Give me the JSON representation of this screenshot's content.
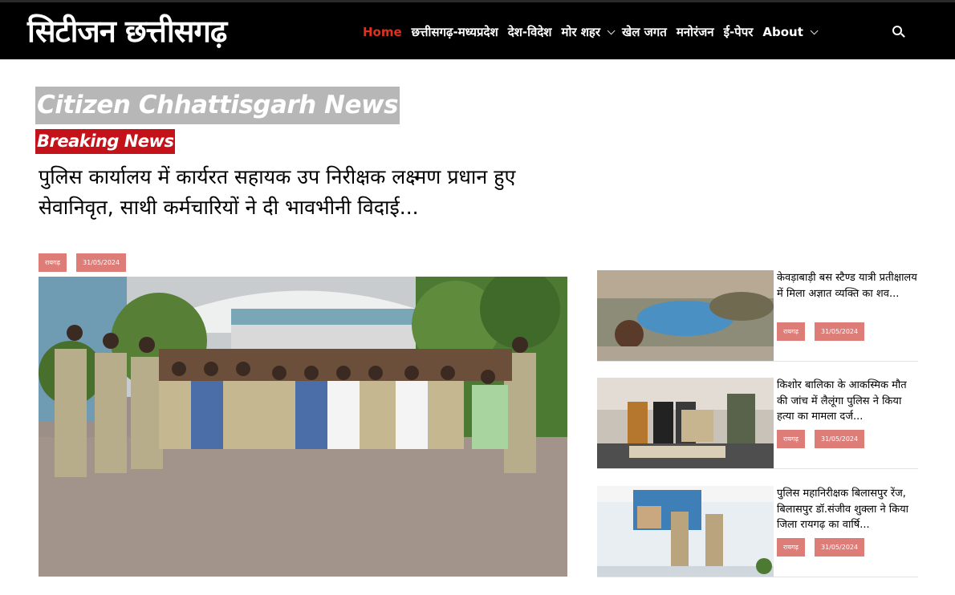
{
  "header": {
    "logo_text": "सिटीजन छत्तीसगढ़",
    "nav": [
      {
        "label": "Home",
        "active": true,
        "dropdown": false
      },
      {
        "label": "छत्तीसगढ़-मध्यप्रदेश",
        "active": false,
        "dropdown": false
      },
      {
        "label": "देश-विदेश",
        "active": false,
        "dropdown": false
      },
      {
        "label": "मोर शहर",
        "active": false,
        "dropdown": true
      },
      {
        "label": "खेल जगत",
        "active": false,
        "dropdown": false
      },
      {
        "label": "मनोरंजन",
        "active": false,
        "dropdown": false
      },
      {
        "label": "ई-पेपर",
        "active": false,
        "dropdown": false
      },
      {
        "label": "About",
        "active": false,
        "dropdown": true
      }
    ],
    "search_icon": "search-icon"
  },
  "banner": {
    "site_name": "Citizen Chhattisgarh News",
    "breaking_label": "Breaking News"
  },
  "main_article": {
    "title": "पुलिस कार्यालय में कार्यरत सहायक उप निरीक्षक लक्ष्मण प्रधान हुए सेवानिवृत, साथी कर्मचारियों ने दी भावभीनी विदाई...",
    "category": "रायगढ़",
    "date": "31/05/2024"
  },
  "sidebar": [
    {
      "title": "केवड़ाबाड़ी बस स्टैण्ड यात्री प्रतीक्षालय में मिला अज्ञात व्यक्ति का शव...",
      "category": "रायगढ़",
      "date": "31/05/2024"
    },
    {
      "title": "किशोर बालिका के आकस्मिक मौत की जांच में लैलूंगा पुलिस ने किया हत्या का मामला दर्ज...",
      "category": "रायगढ़",
      "date": "31/05/2024"
    },
    {
      "title": "पुलिस महानिरीक्षक बिलासपुर रेंज, बिलासपुर डॉ.संजीव शुक्ला ने किया जिला रायगढ़ का वार्षि...",
      "category": "रायगढ़",
      "date": "31/05/2024"
    }
  ],
  "colors": {
    "header_bg": "#000000",
    "nav_active": "#e0301e",
    "banner_bg": "#b7b7b7",
    "breaking_bg": "#c4121a",
    "tag_bg": "#de7d78"
  }
}
